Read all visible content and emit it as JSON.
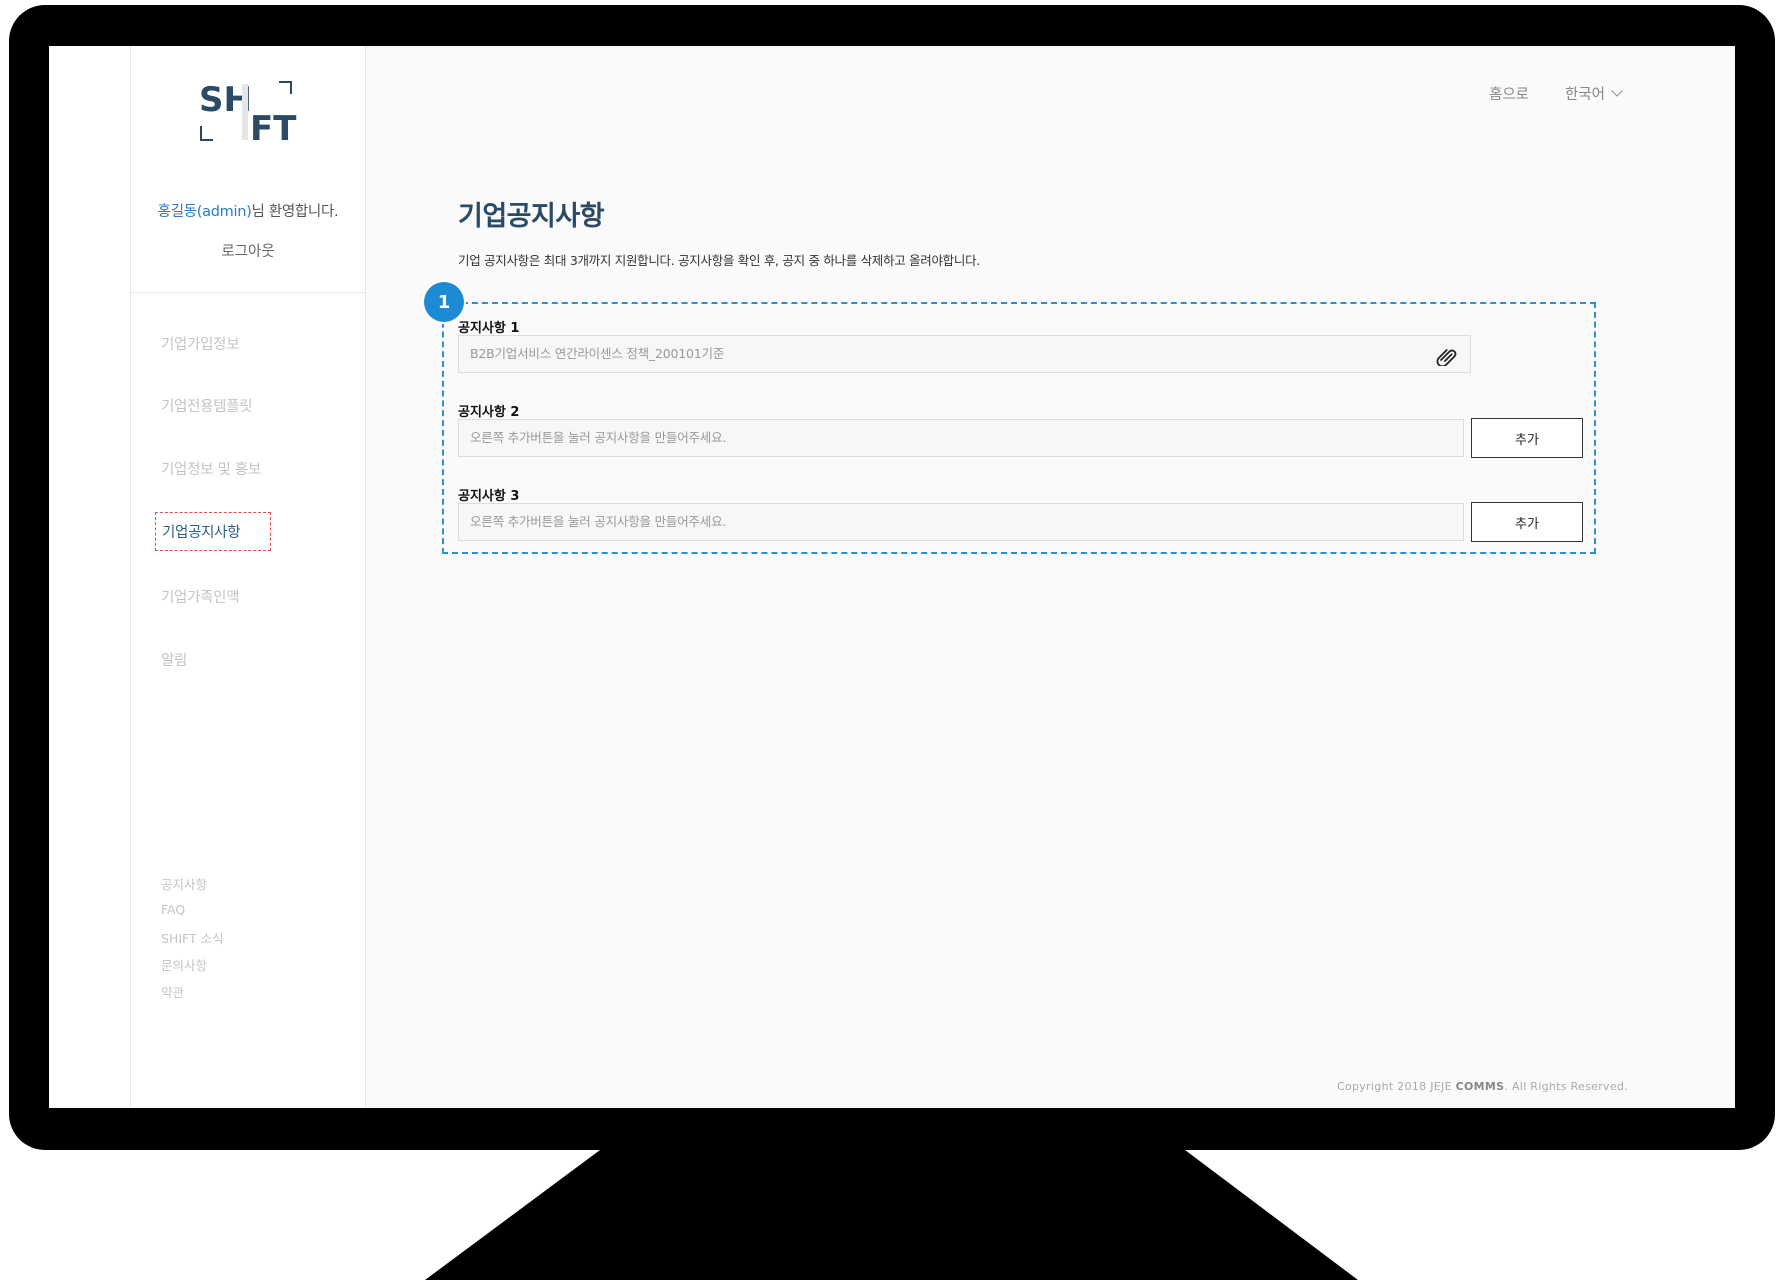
{
  "app": {
    "logo_text": "SHIFT",
    "brand_color": "#2a4a66",
    "accent_color": "#1d8ad6"
  },
  "sidebar": {
    "welcome_user": "홍길동(admin)",
    "welcome_suffix": "님 환영합니다.",
    "logout_label": "로그아웃",
    "menu": [
      {
        "label": "기업가입정보",
        "active": false
      },
      {
        "label": "기업전용템플릿",
        "active": false
      },
      {
        "label": "기업정보 및 홍보",
        "active": false
      },
      {
        "label": "기업공지사항",
        "active": true
      },
      {
        "label": "기업가족인맥",
        "active": false
      },
      {
        "label": "알림",
        "active": false
      }
    ],
    "footer_links": [
      "공지사항",
      "FAQ",
      "SHIFT 소식",
      "문의사항",
      "약관"
    ]
  },
  "header": {
    "home_label": "홈으로",
    "language_label": "한국어"
  },
  "main": {
    "title": "기업공지사항",
    "description": "기업 공지사항은 최대 3개까지 지원합니다. 공지사항을 확인 후, 공지 중 하나를 삭제하고 올려야합니다.",
    "annotation_number": "1",
    "notices": [
      {
        "label": "공지사항 1",
        "value": "B2B기업서비스 연간라이센스 정책_200101기준",
        "icon": "paperclip-icon"
      },
      {
        "label": "공지사항 2",
        "placeholder": "오른쪽 추가버튼을 눌러 공지사항을 만들어주세요.",
        "button": "추가"
      },
      {
        "label": "공지사항 3",
        "placeholder": "오른쪽 추가버튼을 눌러 공지사항을 만들어주세요.",
        "button": "추가"
      }
    ]
  },
  "footer": {
    "copyright_prefix": "Copyright 2018 JEJE ",
    "copyright_brand": "COMMS",
    "copyright_suffix": ". All Rights Reserved."
  }
}
